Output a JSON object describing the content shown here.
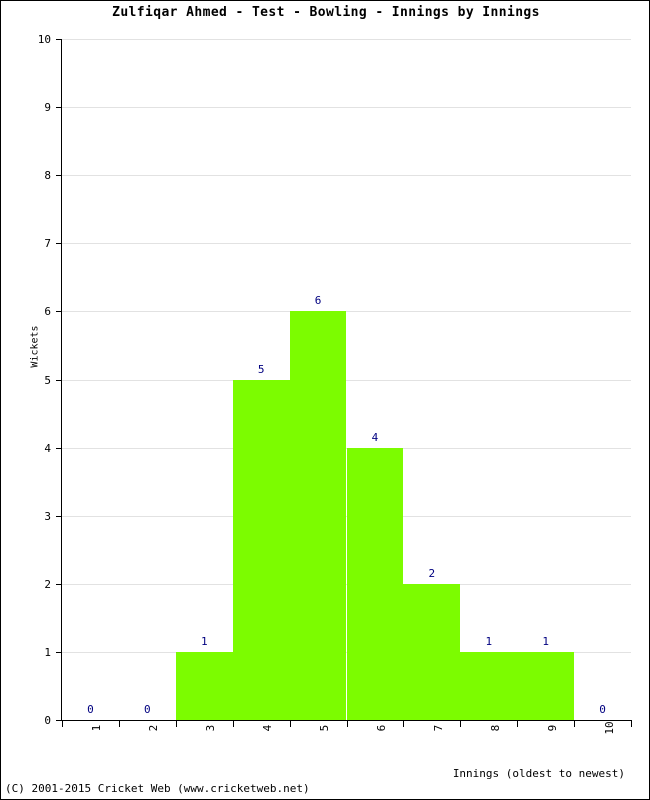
{
  "title": "Zulfiqar Ahmed - Test - Bowling - Innings by Innings",
  "footer": "(C) 2001-2015 Cricket Web (www.cricketweb.net)",
  "chart_data": {
    "type": "bar",
    "title": "Zulfiqar Ahmed - Test - Bowling - Innings by Innings",
    "xlabel": "Innings (oldest to newest)",
    "ylabel": "Wickets",
    "categories": [
      "1",
      "2",
      "3",
      "4",
      "5",
      "6",
      "7",
      "8",
      "9",
      "10"
    ],
    "values": [
      0,
      0,
      1,
      5,
      6,
      4,
      2,
      1,
      1,
      0
    ],
    "data_labels": [
      "0",
      "0",
      "1",
      "5",
      "6",
      "4",
      "2",
      "1",
      "1",
      "0"
    ],
    "ylim": [
      0,
      10
    ],
    "ytick_labels": [
      "0",
      "1",
      "2",
      "3",
      "4",
      "5",
      "6",
      "7",
      "8",
      "9",
      "10"
    ],
    "grid": true,
    "legend": false,
    "bar_color": "#7CFC00",
    "label_color": "#000080",
    "grid_color": "#E2E2E2",
    "axis_color": "#000000"
  }
}
